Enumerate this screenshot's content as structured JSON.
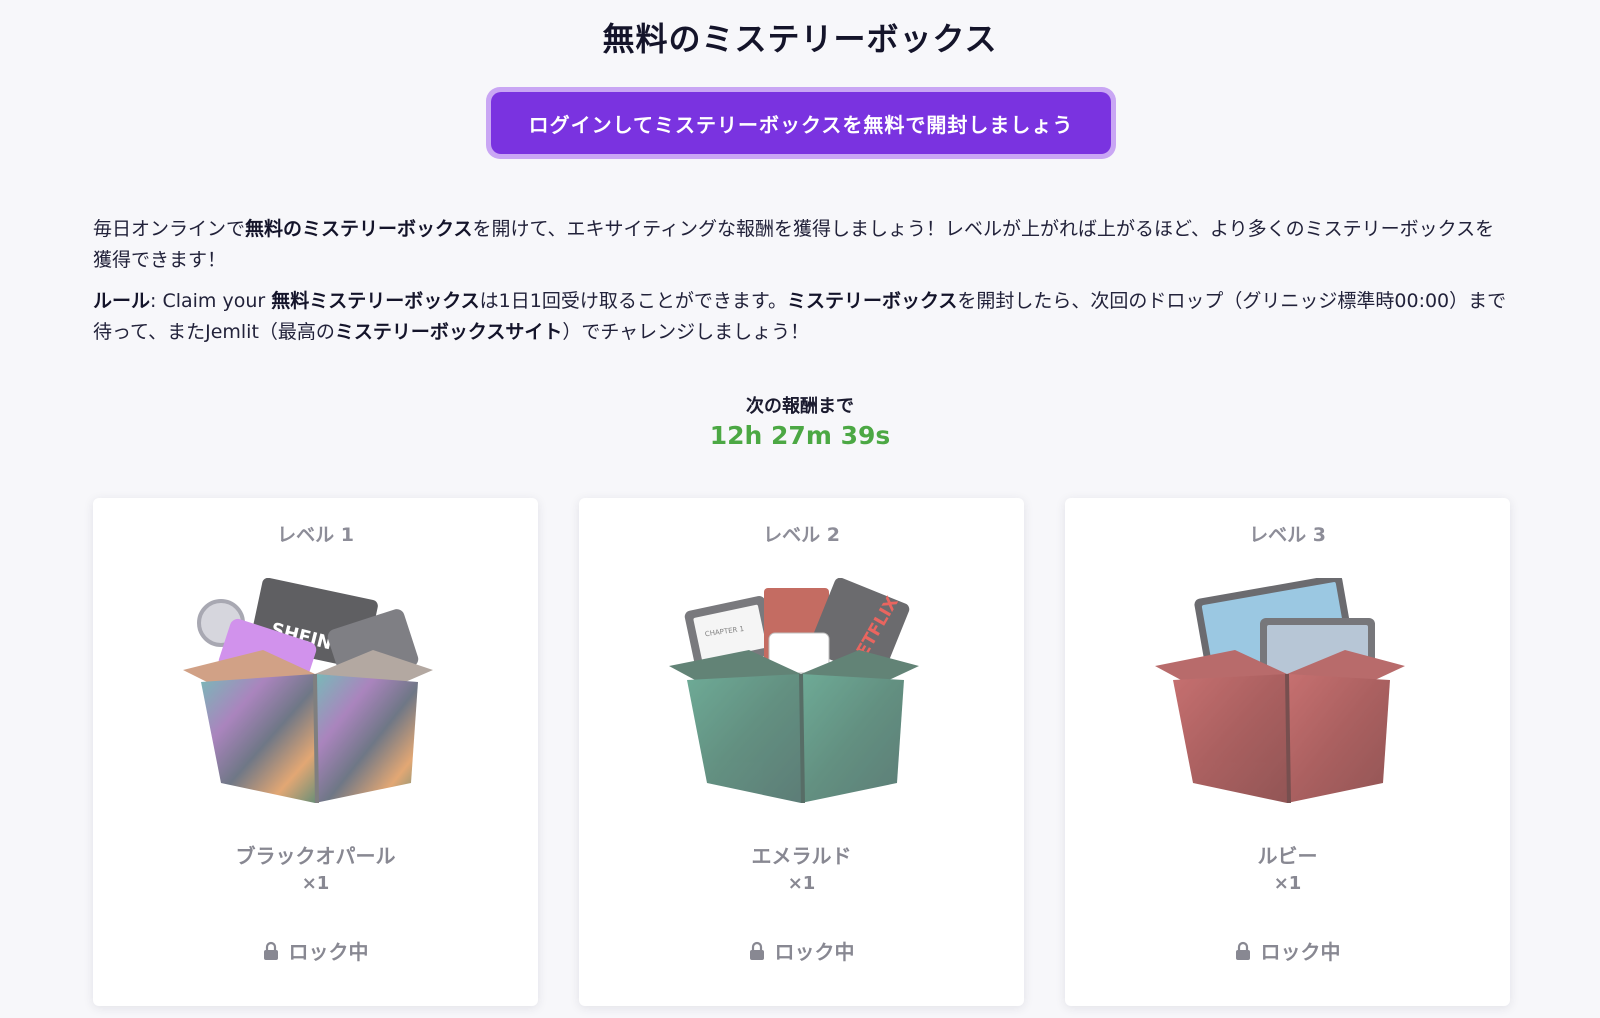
{
  "page_title": "無料のミステリーボックス",
  "login_button": "ログインしてミステリーボックスを無料で開封しましょう",
  "description": {
    "p1_a": "毎日オンラインで",
    "p1_b": "無料のミステリーボックス",
    "p1_c": "を開けて、エキサイティングな報酬を獲得しましょう！レベルが上がれば上がるほど、より多くのミステリーボックスを獲得できます！",
    "p2_rule": "ルール",
    "p2_a": ": Claim your ",
    "p2_b": "無料ミステリーボックス",
    "p2_c": "は1日1回受け取ることができます。",
    "p2_d": "ミステリーボックス",
    "p2_e": "を開封したら、次回のドロップ（グリニッジ標準時00:00）まで待って、またJemlit（最高の",
    "p2_f": "ミステリーボックスサイト",
    "p2_g": "）でチャレンジしましょう！"
  },
  "timer": {
    "label": "次の報酬まで",
    "value": "12h 27m 39s"
  },
  "cards": [
    {
      "level": "レベル 1",
      "name": "ブラックオパール",
      "qty": "×1",
      "status": "ロック中",
      "icon": "lock-icon"
    },
    {
      "level": "レベル 2",
      "name": "エメラルド",
      "qty": "×1",
      "status": "ロック中",
      "icon": "lock-icon"
    },
    {
      "level": "レベル 3",
      "name": "ルビー",
      "qty": "×1",
      "status": "ロック中",
      "icon": "lock-icon"
    }
  ],
  "box_art": {
    "card0": {
      "brand_text": "SHEIN",
      "box_colors": [
        "#3f4a5e",
        "#8e5ca8",
        "#d98a46",
        "#4ba3a0"
      ]
    },
    "card1": {
      "brand_text": "NETFLIX",
      "book_text": "CHAPTER 1",
      "box_colors": [
        "#2f6b57",
        "#3e8f74",
        "#27524a"
      ]
    },
    "card2": {
      "box_colors": [
        "#8e2b2b",
        "#b44141",
        "#6e1d1d"
      ]
    }
  }
}
